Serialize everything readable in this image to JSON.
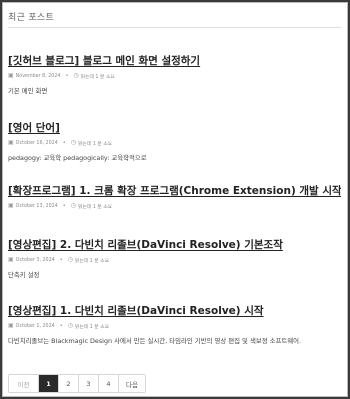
{
  "section": {
    "title": "최근 포스트"
  },
  "posts": [
    {
      "title": "[깃허브 블로그] 블로그 메인 화면 설정하기",
      "date": "November 8, 2024",
      "read_time": "읽는데 1 분 소요",
      "excerpt": "기본 메인 화면"
    },
    {
      "title": "[영어 단어]",
      "date": "October 16, 2024",
      "read_time": "읽는데 1 분 소요",
      "excerpt": "pedagogy: 교육학 pedagogically: 교육학적으로"
    },
    {
      "title": "[확장프로그램] 1. 크롬 확장 프로그램(Chrome Extension) 개발 시작",
      "date": "October 13, 2024",
      "read_time": "읽는데 1 분 소요",
      "excerpt": ""
    },
    {
      "title": "[영상편집] 2. 다빈치 리졸브(DaVinci Resolve) 기본조작",
      "date": "October 3, 2024",
      "read_time": "읽는데 1 분 소요",
      "excerpt": "단축키 설정"
    },
    {
      "title": "[영상편집] 1. 다빈치 리졸브(DaVinci Resolve) 시작",
      "date": "October 1, 2024",
      "read_time": "읽는데 1 분 소요",
      "excerpt": "다빈치리졸브는 Blackmagic Design 사에서 만든 실시간, 타임라인 기반의 영상 편집 및 색보정 소프트웨어."
    }
  ],
  "pagination": {
    "prev": "이전",
    "pages": [
      "1",
      "2",
      "3",
      "4"
    ],
    "current": "1",
    "next": "다음"
  },
  "icons": {
    "calendar": "calendar-icon",
    "clock": "clock-icon"
  },
  "colors": {
    "active_page_bg": "#2a2a2a",
    "title_text": "#222222",
    "meta_text": "#8a8a8a"
  }
}
